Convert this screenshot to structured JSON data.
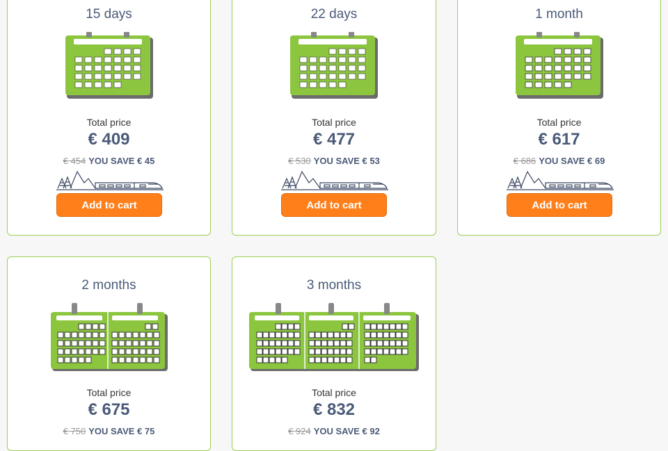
{
  "colors": {
    "card_border": "#9bcf53",
    "calendar_green": "#8cc63f",
    "button_orange": "#ff7f1a",
    "text_navy": "#4a5a78"
  },
  "cards": [
    {
      "title": "15 days",
      "total_label": "Total price",
      "price": "€ 409",
      "old_price": "€ 454",
      "save": "YOU SAVE € 45",
      "button": "Add to cart"
    },
    {
      "title": "22 days",
      "total_label": "Total price",
      "price": "€ 477",
      "old_price": "€ 530",
      "save": "YOU SAVE € 53",
      "button": "Add to cart"
    },
    {
      "title": "1 month",
      "total_label": "Total price",
      "price": "€ 617",
      "old_price": "€ 686",
      "save": "YOU SAVE € 69",
      "button": "Add to cart"
    },
    {
      "title": "2 months",
      "total_label": "Total price",
      "price": "€ 675",
      "old_price": "€ 750",
      "save": "YOU SAVE € 75"
    },
    {
      "title": "3 months",
      "total_label": "Total price",
      "price": "€ 832",
      "old_price": "€ 924",
      "save": "YOU SAVE € 92"
    }
  ],
  "icons": {
    "calendar": "calendar-icon",
    "landscape": "mountain-train-icon"
  }
}
